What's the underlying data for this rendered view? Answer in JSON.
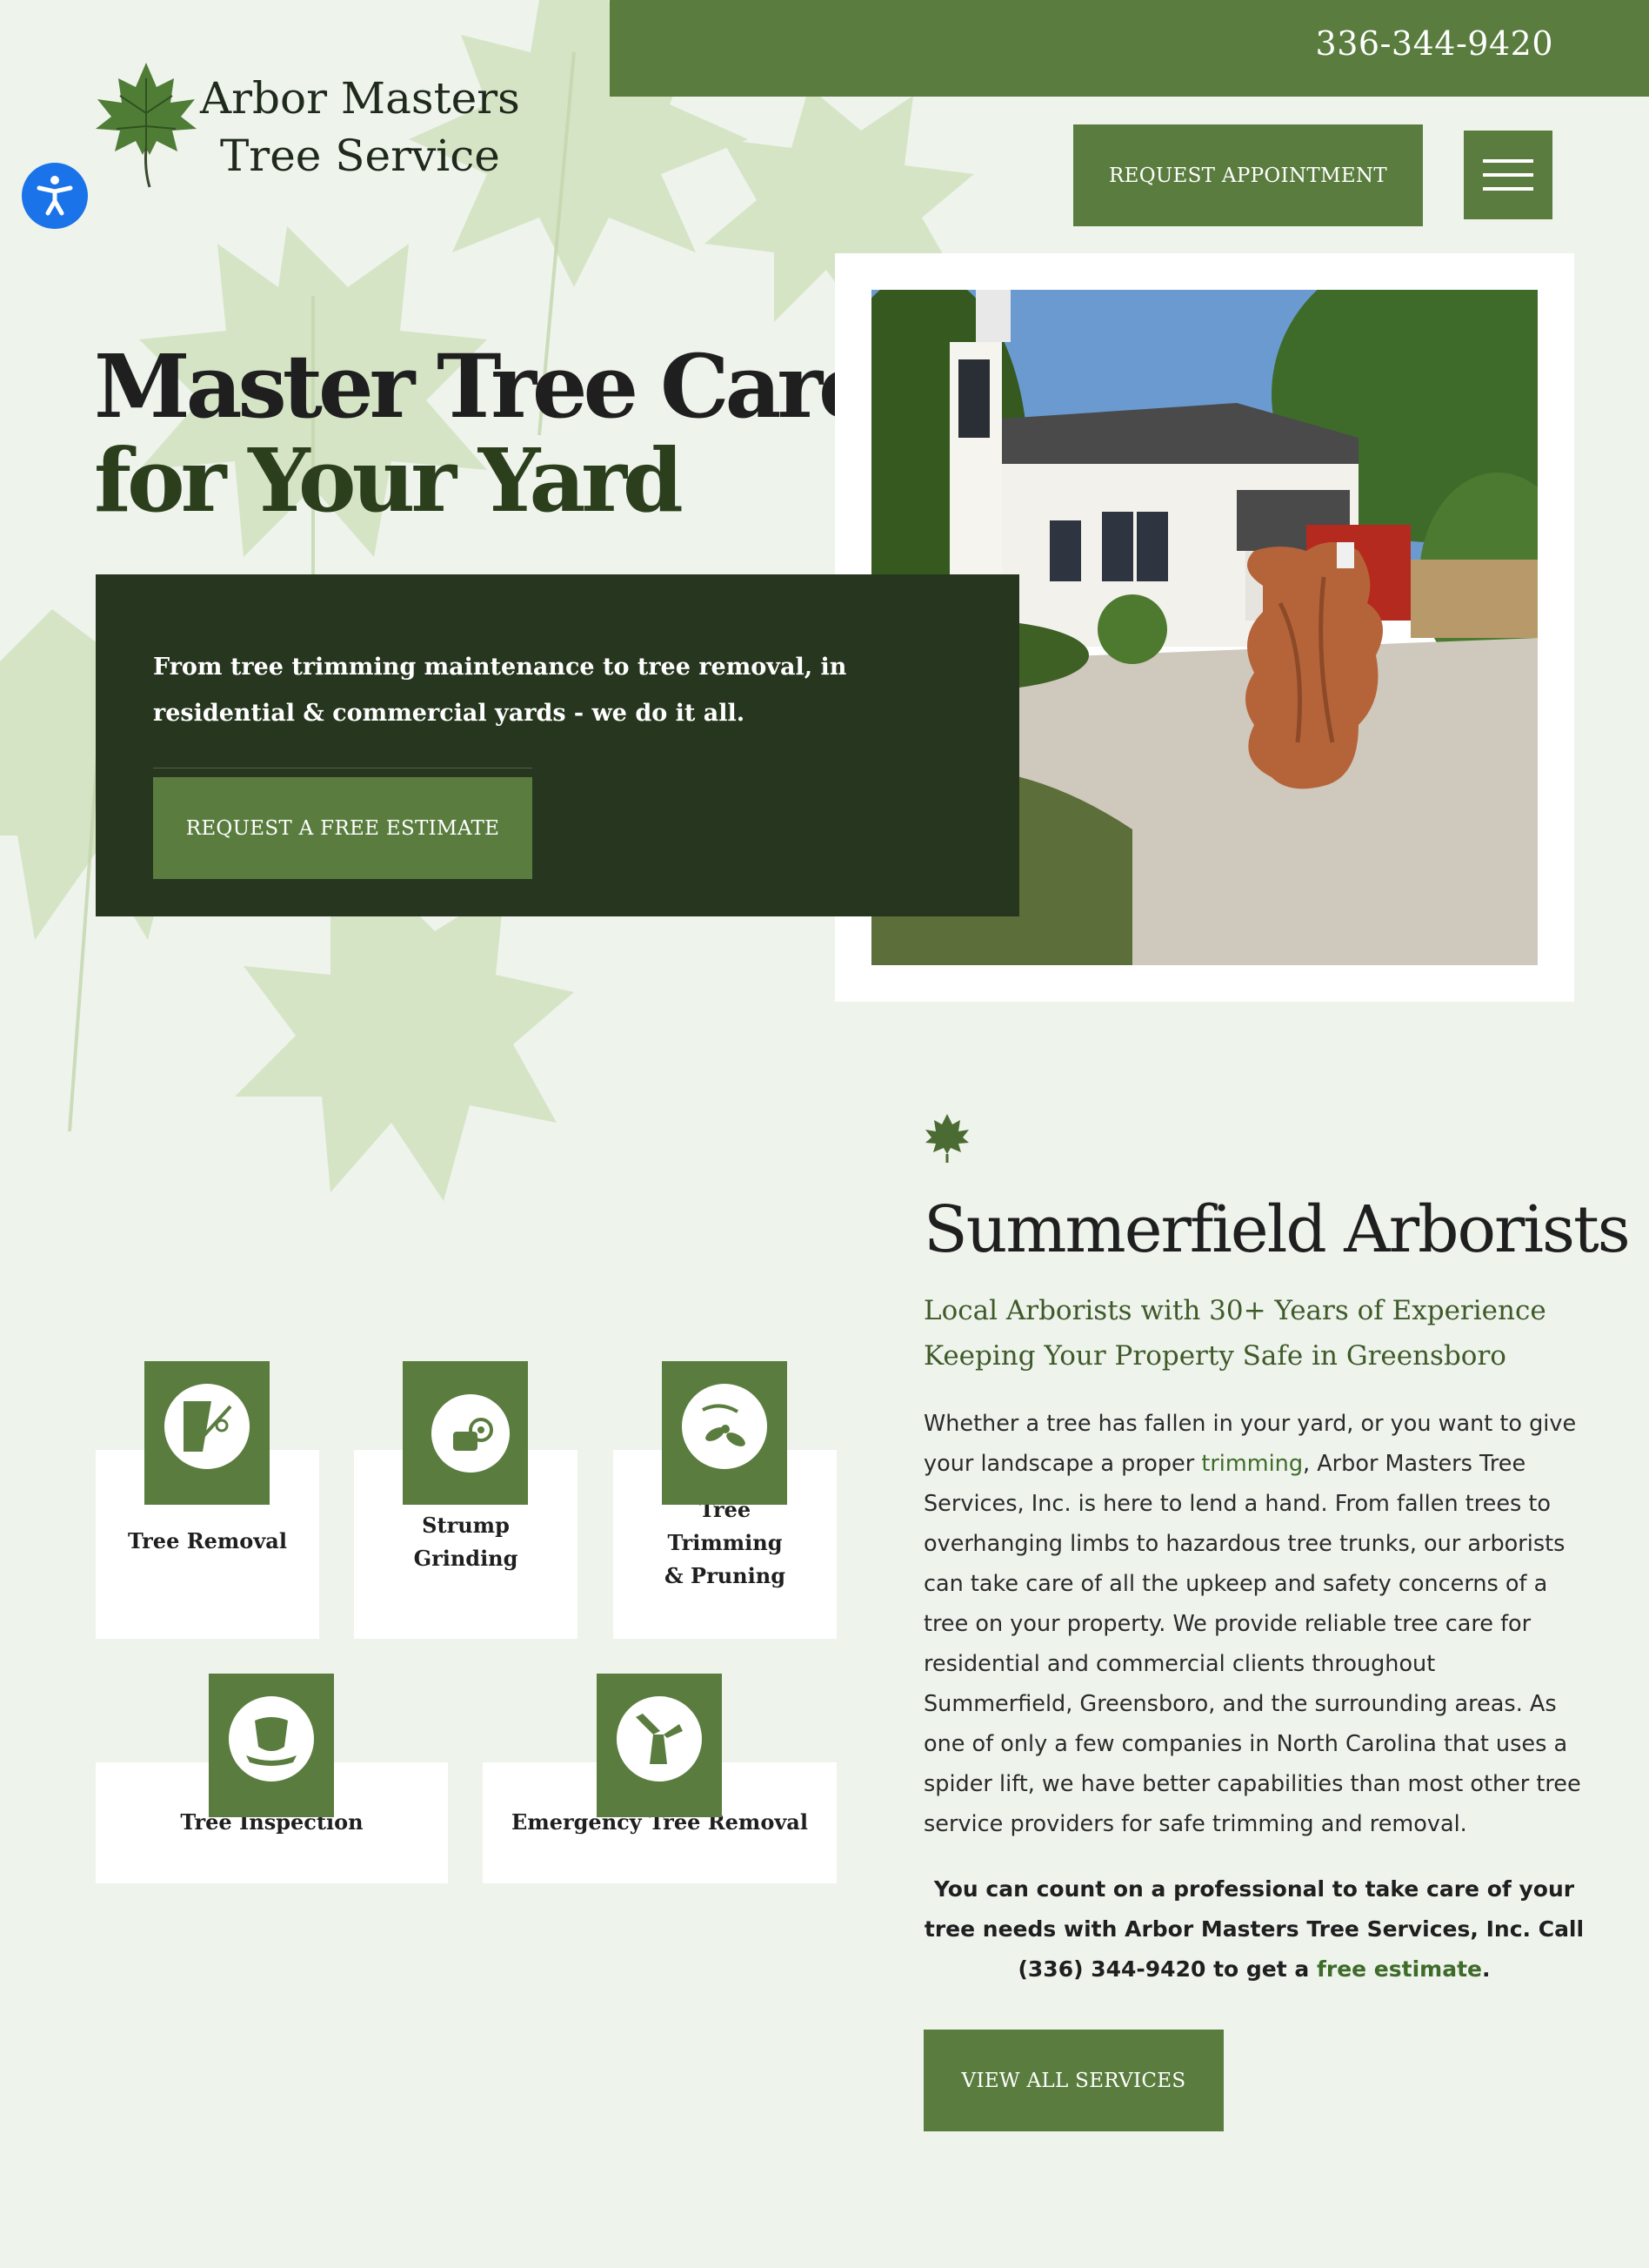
{
  "header": {
    "phone": "336-344-9420",
    "logo_line1": "Arbor Masters",
    "logo_line2": "Tree Service",
    "appointment_label": "REQUEST APPOINTMENT"
  },
  "hero": {
    "title_line1": "Master Tree Care",
    "title_line2": "for Your Yard",
    "description": "From tree trimming maintenance to tree removal, in residential & commercial yards - we do it all.",
    "cta_label": "REQUEST A FREE ESTIMATE"
  },
  "services": [
    {
      "label": "Tree Removal",
      "icon": "saw-cut-icon"
    },
    {
      "label": "Strump Grinding",
      "icon": "stump-grinder-icon"
    },
    {
      "label": "Tree Trimming & Pruning",
      "icon": "pruning-shears-icon"
    },
    {
      "label": "Tree Inspection",
      "icon": "tree-stump-icon"
    },
    {
      "label": "Emergency Tree Removal",
      "icon": "broken-tree-icon"
    }
  ],
  "about": {
    "title": "Summerfield Arborists",
    "subtitle": "Local Arborists with 30+ Years of Experience Keeping Your Property Safe in Greensboro",
    "body_part1": "Whether a tree has fallen in your yard, or you want to give your landscape a proper ",
    "body_link": "trimming",
    "body_part2": ", Arbor Masters Tree Services, Inc. is here to lend a hand. From fallen trees to overhanging limbs to hazardous tree trunks, our arborists can take care of all the upkeep and safety concerns of a tree on your property. We provide reliable tree care for residential and commercial clients throughout Summerfield, Greensboro, and the surrounding areas. As one of only a few companies in North Carolina that uses a spider lift, we have better capabilities than most other tree service providers for safe trimming and removal.",
    "cta_part1": "You can count on a professional to take care of your tree needs with Arbor Masters Tree Services, Inc. Call (336) 344-9420 to get a ",
    "cta_link": "free estimate",
    "cta_part2": ".",
    "button_label": "VIEW ALL SERVICES"
  },
  "colors": {
    "brand_green": "#5a7d3f",
    "dark_green": "#27361e",
    "background": "#eef3ec",
    "accessibility_blue": "#1a73e8"
  }
}
